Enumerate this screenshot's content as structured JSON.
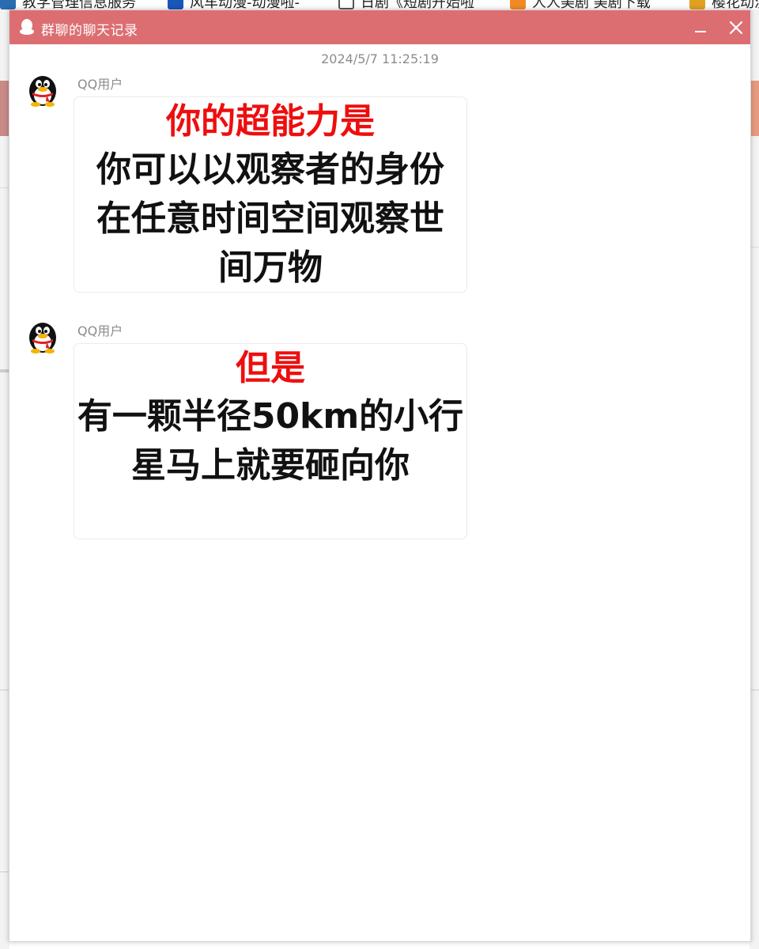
{
  "background": {
    "bookmarks": [
      {
        "label": "教学管理信息服务",
        "icon": "bookmark-favicon-blue",
        "color": "#2b6cb0"
      },
      {
        "label": "风车动漫-动漫啦-",
        "icon": "bookmark-favicon-s",
        "color": "#1a56b8"
      },
      {
        "label": "日剧《短剧开始啦",
        "icon": "bookmark-favicon-doc",
        "color": "#555555"
      },
      {
        "label": "人人美剧 美剧下载",
        "icon": "bookmark-favicon-m",
        "color": "#f08a24"
      },
      {
        "label": "樱花动漫",
        "icon": "bookmark-favicon-sakura",
        "color": "#e0a020"
      }
    ]
  },
  "window": {
    "title": "群聊的聊天记录",
    "title_icon": "qq-penguin-icon",
    "accent_color": "#dc6e72",
    "buttons": {
      "minimize": "minimize-icon",
      "close": "close-icon"
    }
  },
  "chat": {
    "timestamp": "2024/5/7 11:25:19",
    "messages": [
      {
        "sender": "QQ用户",
        "avatar": "qq-penguin-avatar",
        "highlight": "你的超能力是",
        "highlight_color": "#ee0e0e",
        "body_lines": [
          "你可以以观察者的身份",
          "在任意时间空间观察世",
          "间万物"
        ]
      },
      {
        "sender": "QQ用户",
        "avatar": "qq-penguin-avatar",
        "highlight": "但是",
        "highlight_color": "#ee0e0e",
        "body_lines": [
          "有一颗半径50km的小行",
          "星马上就要砸向你"
        ]
      }
    ]
  }
}
